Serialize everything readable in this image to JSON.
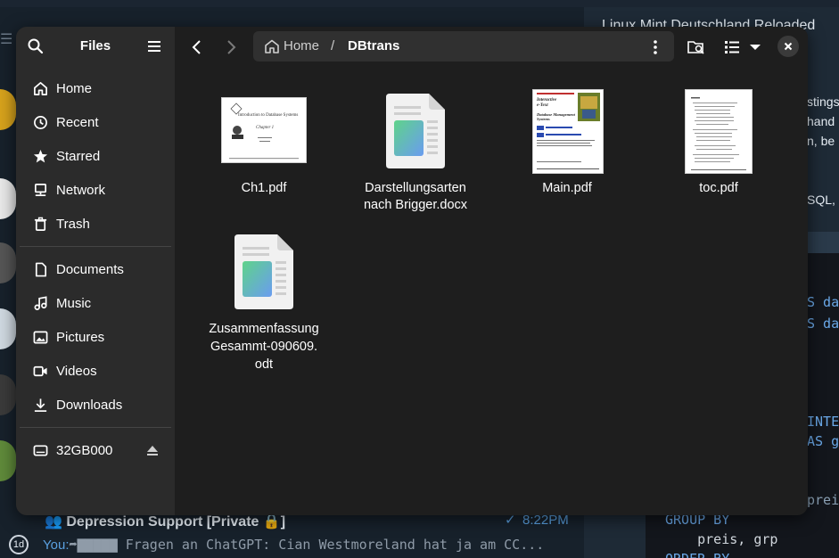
{
  "background": {
    "right_panel_title": "Linux Mint Deutschland Reloaded",
    "right_panel_fragments": [
      "stings",
      "hand",
      "n, be",
      "SQL, c"
    ],
    "code_fragments": [
      "S dat",
      "S dat",
      "INTE",
      "AS g",
      "preis",
      "GROUP BY",
      "    preis, grp",
      "ORDER BY"
    ],
    "chat": {
      "title": "Depression Support [Private 🔒]",
      "time": "8:22PM",
      "sender": "You:",
      "preview": " Fragen an ChatGPT: Cian Westmoreland hat ja am CC...",
      "badge": "1d"
    }
  },
  "window": {
    "sidebar": {
      "title": "Files",
      "places": [
        {
          "label": "Home",
          "icon": "home-icon"
        },
        {
          "label": "Recent",
          "icon": "clock-icon"
        },
        {
          "label": "Starred",
          "icon": "star-icon"
        },
        {
          "label": "Network",
          "icon": "network-icon"
        },
        {
          "label": "Trash",
          "icon": "trash-icon"
        }
      ],
      "bookmarks": [
        {
          "label": "Documents",
          "icon": "document-icon"
        },
        {
          "label": "Music",
          "icon": "music-icon"
        },
        {
          "label": "Pictures",
          "icon": "picture-icon"
        },
        {
          "label": "Videos",
          "icon": "video-icon"
        },
        {
          "label": "Downloads",
          "icon": "download-icon"
        }
      ],
      "devices": [
        {
          "label": "32GB000",
          "icon": "drive-icon"
        }
      ]
    },
    "pathbar": {
      "home_label": "Home",
      "separator": "/",
      "current": "DBtrans"
    },
    "files": [
      {
        "name_lines": [
          "Ch1.pdf"
        ],
        "type": "pdf"
      },
      {
        "name_lines": [
          "Darstellungsarten",
          "nach Brigger.docx"
        ],
        "type": "document"
      },
      {
        "name_lines": [
          "Main.pdf"
        ],
        "type": "pdf"
      },
      {
        "name_lines": [
          "toc.pdf"
        ],
        "type": "pdf"
      },
      {
        "name_lines": [
          "Zusammenfassung",
          "Gesammt-090609.",
          "odt"
        ],
        "type": "document"
      }
    ],
    "thumb_text": {
      "ch1_title": "Introduction to Database Systems",
      "ch1_chapter": "Chapter 1",
      "main_title": "Interactive e-Text Database Management Systems"
    }
  },
  "colors": {
    "window_bg": "#1e1e1e",
    "sidebar_bg": "#2b2b2b",
    "pathbar_bg": "#303030",
    "accent_blue": "#5aa0e0"
  }
}
